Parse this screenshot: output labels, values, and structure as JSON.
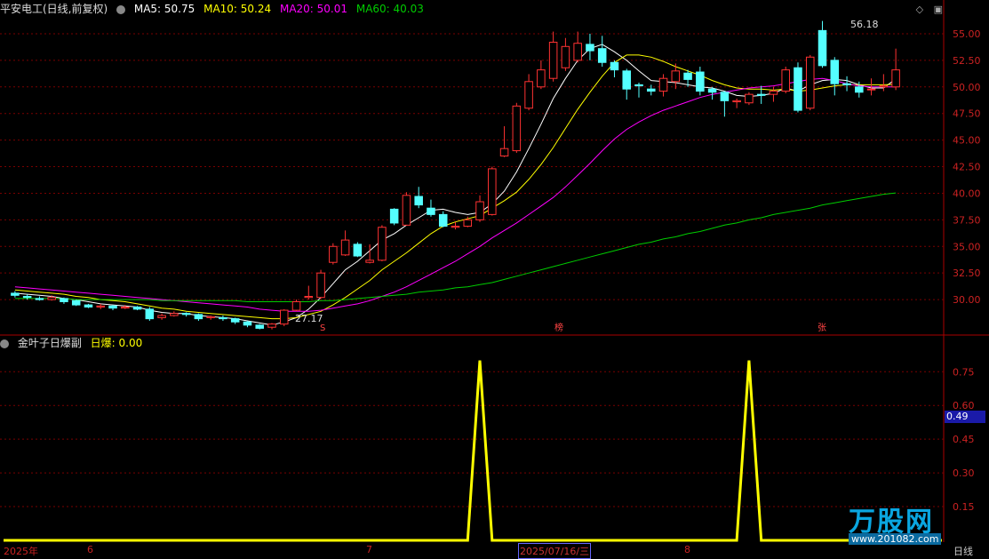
{
  "header": {
    "stock_name": "平安电工(日线,前复权)",
    "ma5": "MA5: 50.75",
    "ma10": "MA10: 50.24",
    "ma20": "MA20: 50.01",
    "ma60": "MA60: 40.03"
  },
  "sub_header": {
    "indicator_name": "金叶子日爆副",
    "series_label": "日爆: 0.00"
  },
  "current_value_tag": "0.49",
  "price_annotations": {
    "high": "56.18",
    "low": "27.17"
  },
  "event_markers": [
    "S",
    "榜",
    "张"
  ],
  "x_axis": {
    "labels": [
      "2025年",
      "6",
      "7",
      "2025/07/16/三",
      "8"
    ],
    "right_label": "日线"
  },
  "watermark": {
    "logo": "万股网",
    "url": "www.201082.com"
  },
  "colors": {
    "up": "#ff3232",
    "down": "#54ffff",
    "ma5": "#ffffff",
    "ma10": "#ffff00",
    "ma20": "#ff00ff",
    "ma60": "#00cc00",
    "indicator": "#ffff00",
    "grid": "#7a0000"
  },
  "chart_data": [
    {
      "type": "candlestick",
      "title": "平安电工(日线,前复权)",
      "y_ticks": [
        30.0,
        32.5,
        35.0,
        37.5,
        40.0,
        42.5,
        45.0,
        47.5,
        50.0,
        52.5,
        55.0
      ],
      "ylim": [
        27.0,
        56.5
      ],
      "candles": [
        [
          30.6,
          30.4,
          30.8,
          30.2
        ],
        [
          30.3,
          30.2,
          30.5,
          30.0
        ],
        [
          30.1,
          30.0,
          30.3,
          29.9
        ],
        [
          30.0,
          30.2,
          30.4,
          29.9
        ],
        [
          30.1,
          29.8,
          30.2,
          29.6
        ],
        [
          29.9,
          29.5,
          30.0,
          29.4
        ],
        [
          29.5,
          29.3,
          29.6,
          29.2
        ],
        [
          29.3,
          29.4,
          29.6,
          29.1
        ],
        [
          29.4,
          29.2,
          29.5,
          29.0
        ],
        [
          29.2,
          29.3,
          29.5,
          29.1
        ],
        [
          29.3,
          29.1,
          29.4,
          29.0
        ],
        [
          29.1,
          28.2,
          29.3,
          28.0
        ],
        [
          28.3,
          28.5,
          28.7,
          28.1
        ],
        [
          28.5,
          28.7,
          28.9,
          28.4
        ],
        [
          28.7,
          28.6,
          28.8,
          28.4
        ],
        [
          28.6,
          28.2,
          28.7,
          28.0
        ],
        [
          28.3,
          28.4,
          28.5,
          28.1
        ],
        [
          28.3,
          28.2,
          28.5,
          28.0
        ],
        [
          28.2,
          27.9,
          28.3,
          27.7
        ],
        [
          27.9,
          27.6,
          28.0,
          27.4
        ],
        [
          27.6,
          27.3,
          27.7,
          27.2
        ],
        [
          27.4,
          27.7,
          27.8,
          27.2
        ],
        [
          27.7,
          29.0,
          29.1,
          27.5
        ],
        [
          29.0,
          29.8,
          30.0,
          28.9
        ],
        [
          30.2,
          30.3,
          31.3,
          30.0
        ],
        [
          30.2,
          32.5,
          32.8,
          30.1
        ],
        [
          33.5,
          35.0,
          35.3,
          33.3
        ],
        [
          34.2,
          35.6,
          36.5,
          34.1
        ],
        [
          35.2,
          34.1,
          35.4,
          34.0
        ],
        [
          33.5,
          33.7,
          35.2,
          33.4
        ],
        [
          33.7,
          36.8,
          37.0,
          33.6
        ],
        [
          38.5,
          37.2,
          38.6,
          37.0
        ],
        [
          37.0,
          39.8,
          40.1,
          37.0
        ],
        [
          39.7,
          38.9,
          40.6,
          38.6
        ],
        [
          38.6,
          38.0,
          39.4,
          37.8
        ],
        [
          38.0,
          36.9,
          38.3,
          36.8
        ],
        [
          36.8,
          36.9,
          37.3,
          36.6
        ],
        [
          36.9,
          37.5,
          37.8,
          36.8
        ],
        [
          37.5,
          39.2,
          39.8,
          37.3
        ],
        [
          38.0,
          42.3,
          42.5,
          37.9
        ],
        [
          43.5,
          44.2,
          46.3,
          43.4
        ],
        [
          44.0,
          48.2,
          48.5,
          43.8
        ],
        [
          48.0,
          50.5,
          51.2,
          47.8
        ],
        [
          50.0,
          51.6,
          52.5,
          49.8
        ],
        [
          50.8,
          54.2,
          55.2,
          50.5
        ],
        [
          51.8,
          53.8,
          54.6,
          51.5
        ],
        [
          52.5,
          54.1,
          55.2,
          52.3
        ],
        [
          54.0,
          53.4,
          55.0,
          52.5
        ],
        [
          53.6,
          52.3,
          54.8,
          51.9
        ],
        [
          52.3,
          51.6,
          52.5,
          50.9
        ],
        [
          51.5,
          49.8,
          51.7,
          48.8
        ],
        [
          50.2,
          50.1,
          50.4,
          49.0
        ],
        [
          49.8,
          49.6,
          50.2,
          49.2
        ],
        [
          49.6,
          50.8,
          51.2,
          49.1
        ],
        [
          50.5,
          51.5,
          52.2,
          49.8
        ],
        [
          51.3,
          50.7,
          51.6,
          50.0
        ],
        [
          51.4,
          49.6,
          51.9,
          49.2
        ],
        [
          49.8,
          49.5,
          50.0,
          48.8
        ],
        [
          49.5,
          48.7,
          49.6,
          47.2
        ],
        [
          48.6,
          48.7,
          48.9,
          48.0
        ],
        [
          48.5,
          49.3,
          49.5,
          48.3
        ],
        [
          49.3,
          49.2,
          50.1,
          48.4
        ],
        [
          49.3,
          49.6,
          50.0,
          48.6
        ],
        [
          49.6,
          51.6,
          51.9,
          49.4
        ],
        [
          51.8,
          47.8,
          52.3,
          47.6
        ],
        [
          48.0,
          52.8,
          53.0,
          47.8
        ],
        [
          55.3,
          52.0,
          56.2,
          51.8
        ],
        [
          52.5,
          50.3,
          52.8,
          49.2
        ],
        [
          50.3,
          50.2,
          51.0,
          49.6
        ],
        [
          50.0,
          49.5,
          50.5,
          49.0
        ],
        [
          49.8,
          49.8,
          50.8,
          49.2
        ],
        [
          50.0,
          50.1,
          51.2,
          49.6
        ],
        [
          50.0,
          51.6,
          53.6,
          49.7
        ]
      ],
      "series": [
        {
          "name": "MA5",
          "values": [
            30.6,
            30.5,
            30.4,
            30.3,
            30.1,
            30.0,
            29.8,
            29.6,
            29.5,
            29.4,
            29.3,
            29.0,
            28.8,
            28.7,
            28.7,
            28.5,
            28.4,
            28.3,
            28.2,
            28.0,
            27.8,
            27.6,
            27.9,
            28.3,
            29.1,
            30.2,
            31.5,
            32.8,
            33.6,
            34.6,
            35.6,
            36.2,
            37.0,
            37.7,
            38.4,
            38.5,
            38.2,
            38.0,
            38.2,
            39.0,
            40.2,
            42.0,
            44.2,
            46.5,
            48.9,
            50.8,
            52.5,
            53.6,
            54.0,
            53.3,
            52.5,
            51.5,
            50.6,
            50.5,
            50.4,
            50.2,
            50.0,
            49.9,
            49.6,
            49.2,
            49.1,
            49.2,
            49.4,
            49.9,
            49.6,
            50.2,
            50.6,
            50.7,
            50.6,
            50.2,
            49.9,
            49.9,
            50.75
          ]
        },
        {
          "name": "MA10",
          "values": [
            30.9,
            30.8,
            30.7,
            30.6,
            30.5,
            30.3,
            30.2,
            30.0,
            29.9,
            29.8,
            29.6,
            29.4,
            29.2,
            29.1,
            28.9,
            28.8,
            28.7,
            28.6,
            28.5,
            28.4,
            28.3,
            28.2,
            28.2,
            28.3,
            28.6,
            28.9,
            29.5,
            30.2,
            31.0,
            31.8,
            32.8,
            33.6,
            34.4,
            35.3,
            36.2,
            36.9,
            37.3,
            37.6,
            37.9,
            38.6,
            39.3,
            40.1,
            41.3,
            42.7,
            44.3,
            46.1,
            47.9,
            49.5,
            51.0,
            52.3,
            53.0,
            53.0,
            52.8,
            52.4,
            51.9,
            51.5,
            51.1,
            50.6,
            50.2,
            49.9,
            49.8,
            49.8,
            49.7,
            49.8,
            49.6,
            49.7,
            49.9,
            50.1,
            50.2,
            50.2,
            50.2,
            50.2,
            50.24
          ]
        },
        {
          "name": "MA20",
          "values": [
            31.2,
            31.1,
            31.0,
            30.9,
            30.8,
            30.7,
            30.6,
            30.5,
            30.4,
            30.3,
            30.2,
            30.1,
            30.0,
            29.9,
            29.8,
            29.7,
            29.6,
            29.5,
            29.4,
            29.3,
            29.1,
            29.0,
            28.9,
            28.9,
            28.9,
            29.0,
            29.2,
            29.4,
            29.6,
            29.9,
            30.3,
            30.7,
            31.2,
            31.8,
            32.4,
            33.0,
            33.6,
            34.3,
            35.0,
            35.8,
            36.5,
            37.2,
            38.0,
            38.8,
            39.6,
            40.6,
            41.7,
            42.8,
            44.0,
            45.1,
            46.0,
            46.7,
            47.3,
            47.8,
            48.2,
            48.6,
            49.0,
            49.3,
            49.5,
            49.7,
            49.9,
            50.0,
            50.1,
            50.3,
            50.5,
            50.7,
            50.8,
            50.6,
            50.3,
            50.1,
            50.0,
            50.0,
            50.01
          ]
        },
        {
          "name": "MA60",
          "values": [
            30.1,
            30.1,
            30.1,
            30.1,
            30.1,
            30.0,
            30.0,
            30.0,
            30.0,
            30.0,
            30.0,
            30.0,
            29.9,
            29.9,
            29.9,
            29.9,
            29.9,
            29.9,
            29.9,
            29.8,
            29.8,
            29.8,
            29.8,
            29.8,
            29.8,
            29.9,
            29.9,
            30.0,
            30.1,
            30.2,
            30.3,
            30.4,
            30.5,
            30.7,
            30.8,
            30.9,
            31.1,
            31.2,
            31.4,
            31.6,
            31.9,
            32.2,
            32.5,
            32.8,
            33.1,
            33.4,
            33.7,
            34.0,
            34.3,
            34.6,
            34.9,
            35.2,
            35.4,
            35.7,
            35.9,
            36.2,
            36.4,
            36.7,
            37.0,
            37.2,
            37.5,
            37.7,
            38.0,
            38.2,
            38.4,
            38.6,
            38.9,
            39.1,
            39.3,
            39.5,
            39.7,
            39.9,
            40.03
          ]
        }
      ]
    },
    {
      "type": "line",
      "title": "金叶子日爆副",
      "y_ticks": [
        0.15,
        0.3,
        0.45,
        0.6,
        0.75
      ],
      "ylim": [
        0,
        0.85
      ],
      "series": [
        {
          "name": "日爆",
          "values": [
            0,
            0,
            0,
            0,
            0,
            0,
            0,
            0,
            0,
            0,
            0,
            0,
            0,
            0,
            0,
            0,
            0,
            0,
            0,
            0,
            0,
            0,
            0,
            0,
            0,
            0,
            0,
            0,
            0,
            0,
            0,
            0,
            0,
            0,
            0,
            0,
            0,
            0,
            0.8,
            0,
            0,
            0,
            0,
            0,
            0,
            0,
            0,
            0,
            0,
            0,
            0,
            0,
            0,
            0,
            0,
            0,
            0,
            0,
            0,
            0,
            0.8,
            0,
            0,
            0,
            0,
            0,
            0,
            0,
            0,
            0,
            0,
            0,
            0
          ]
        }
      ]
    }
  ]
}
